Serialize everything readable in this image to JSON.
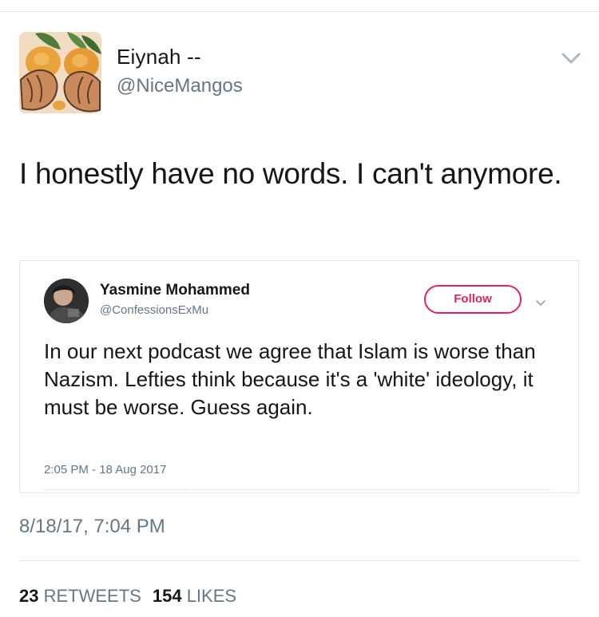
{
  "tweet": {
    "author_name": "Eiynah --",
    "author_handle": "@NiceMangos",
    "text": "I honestly have no words. I can't anymore.",
    "date": "8/18/17, 7:04 PM",
    "retweets_count": "23",
    "retweets_label": "RETWEETS",
    "likes_count": "154",
    "likes_label": "LIKES",
    "menu_icon": "chevron-down-icon"
  },
  "quoted": {
    "author_name": "Yasmine Mohammed",
    "author_handle": "@ConfessionsExMu",
    "follow_label": "Follow",
    "text": "In our next podcast we agree that Islam is worse than Nazism. Lefties think because it's a 'white' ideology, it must be worse. Guess again.",
    "timestamp": "2:05 PM - 18 Aug 2017",
    "menu_icon": "chevron-down-icon"
  },
  "colors": {
    "text_primary": "#14171a",
    "text_secondary": "#657786",
    "follow_accent": "#e0245e",
    "divider": "#e1e8ed"
  }
}
